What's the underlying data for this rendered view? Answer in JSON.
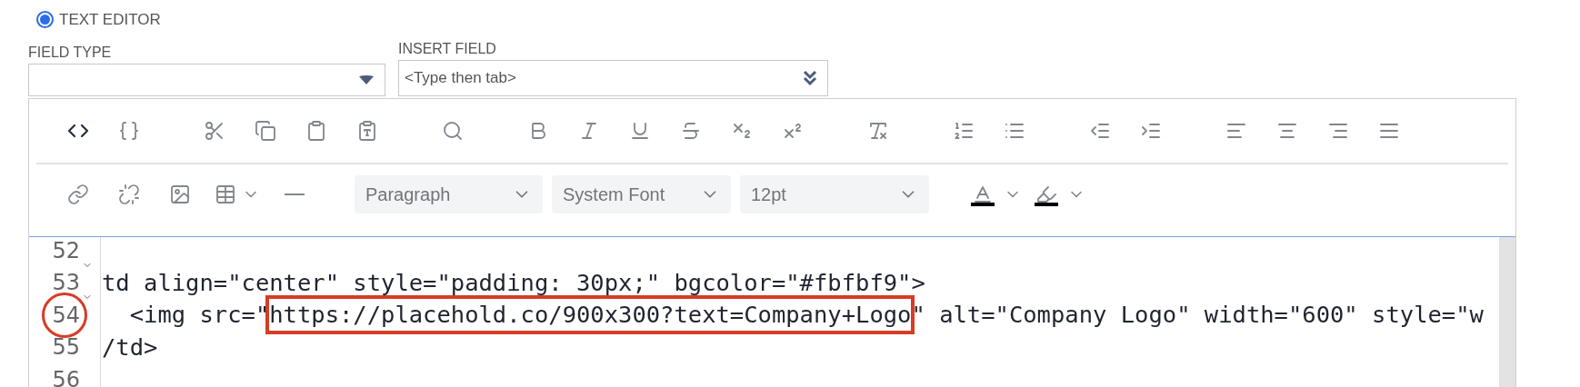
{
  "mode_radio": {
    "label": "TEXT EDITOR",
    "selected": true
  },
  "field_type": {
    "label": "FIELD TYPE"
  },
  "insert_field": {
    "label": "INSERT FIELD",
    "placeholder": "<Type then tab>"
  },
  "toolbar_row_1": [
    [
      {
        "kind": "source-code",
        "selected": true
      },
      {
        "kind": "braces",
        "selected": false
      }
    ],
    [
      {
        "kind": "cut",
        "selected": false
      },
      {
        "kind": "copy",
        "selected": false
      },
      {
        "kind": "paste",
        "selected": false
      },
      {
        "kind": "paste-text",
        "selected": false
      }
    ],
    [
      {
        "kind": "search",
        "selected": false
      }
    ],
    [
      {
        "kind": "bold",
        "selected": false
      },
      {
        "kind": "italic",
        "selected": false
      },
      {
        "kind": "underline",
        "selected": false
      },
      {
        "kind": "strikethrough",
        "selected": false
      },
      {
        "kind": "subscript",
        "selected": false
      },
      {
        "kind": "superscript",
        "selected": false
      }
    ],
    [
      {
        "kind": "clear-formatting",
        "selected": false
      }
    ],
    [
      {
        "kind": "numbered-list",
        "selected": false
      },
      {
        "kind": "bullet-list",
        "selected": false
      }
    ],
    [
      {
        "kind": "outdent",
        "selected": false
      },
      {
        "kind": "indent",
        "selected": false
      }
    ],
    [
      {
        "kind": "align-left",
        "selected": false
      },
      {
        "kind": "align-center",
        "selected": false
      },
      {
        "kind": "align-right",
        "selected": false
      },
      {
        "kind": "justify",
        "selected": false
      }
    ]
  ],
  "toolbar_row_2": [
    {
      "kind": "link"
    },
    {
      "kind": "unlink"
    },
    {
      "kind": "image"
    },
    {
      "kind": "table"
    },
    {
      "kind": "horizontal-rule"
    },
    {
      "kind": "select",
      "value": "Paragraph"
    },
    {
      "kind": "select",
      "value": "System Font"
    },
    {
      "kind": "select",
      "value": "12pt"
    },
    {
      "kind": "text-color",
      "color": "#000000"
    },
    {
      "kind": "highlight",
      "color": "#000000"
    }
  ],
  "code": {
    "lines": [
      {
        "number": "52",
        "fold": true
      },
      {
        "number": "53",
        "fold": true,
        "text": "td align=\"center\" style=\"padding: 30px;\" bgcolor=\"#fbfbf9\">"
      },
      {
        "number": "54",
        "fold": false,
        "circled": true,
        "segments": [
          {
            "text": "  <img src=\"",
            "boxed": false
          },
          {
            "text": "https://placehold.co/900x300?text=Company+Logo",
            "boxed": true
          },
          {
            "text": "\" alt=\"Company Logo\" width=\"600\" style=\"w",
            "boxed": false
          }
        ]
      },
      {
        "number": "55",
        "fold": false,
        "text": "/td>"
      },
      {
        "number": "56",
        "fold": false
      }
    ]
  }
}
